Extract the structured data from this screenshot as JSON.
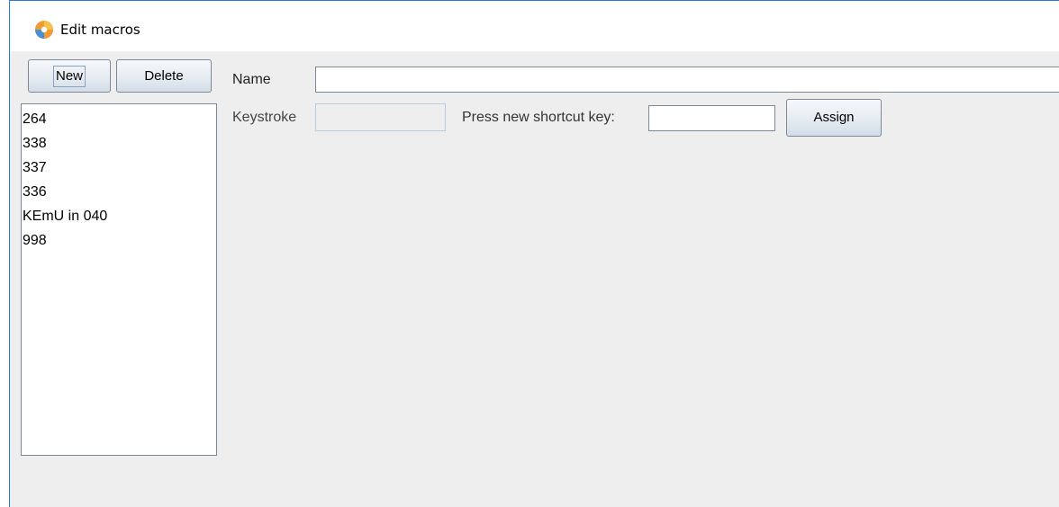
{
  "window": {
    "title": "Edit macros",
    "icon": "app-logo-icon"
  },
  "toolbar": {
    "new_label": "New",
    "delete_label": "Delete"
  },
  "macros": {
    "items": [
      {
        "label": "264"
      },
      {
        "label": "338"
      },
      {
        "label": "337"
      },
      {
        "label": "336"
      },
      {
        "label": "KEmU in 040"
      },
      {
        "label": "998"
      }
    ]
  },
  "form": {
    "name_label": "Name",
    "name_value": "",
    "keystroke_label": "Keystroke",
    "keystroke_value": "",
    "press_label": "Press new shortcut key:",
    "shortcut_value": "",
    "assign_label": "Assign"
  },
  "colors": {
    "window_border": "#2b79d6",
    "background": "#eeeeee",
    "icon_orange": "#f29a2e",
    "icon_blue": "#4a8fd4"
  }
}
